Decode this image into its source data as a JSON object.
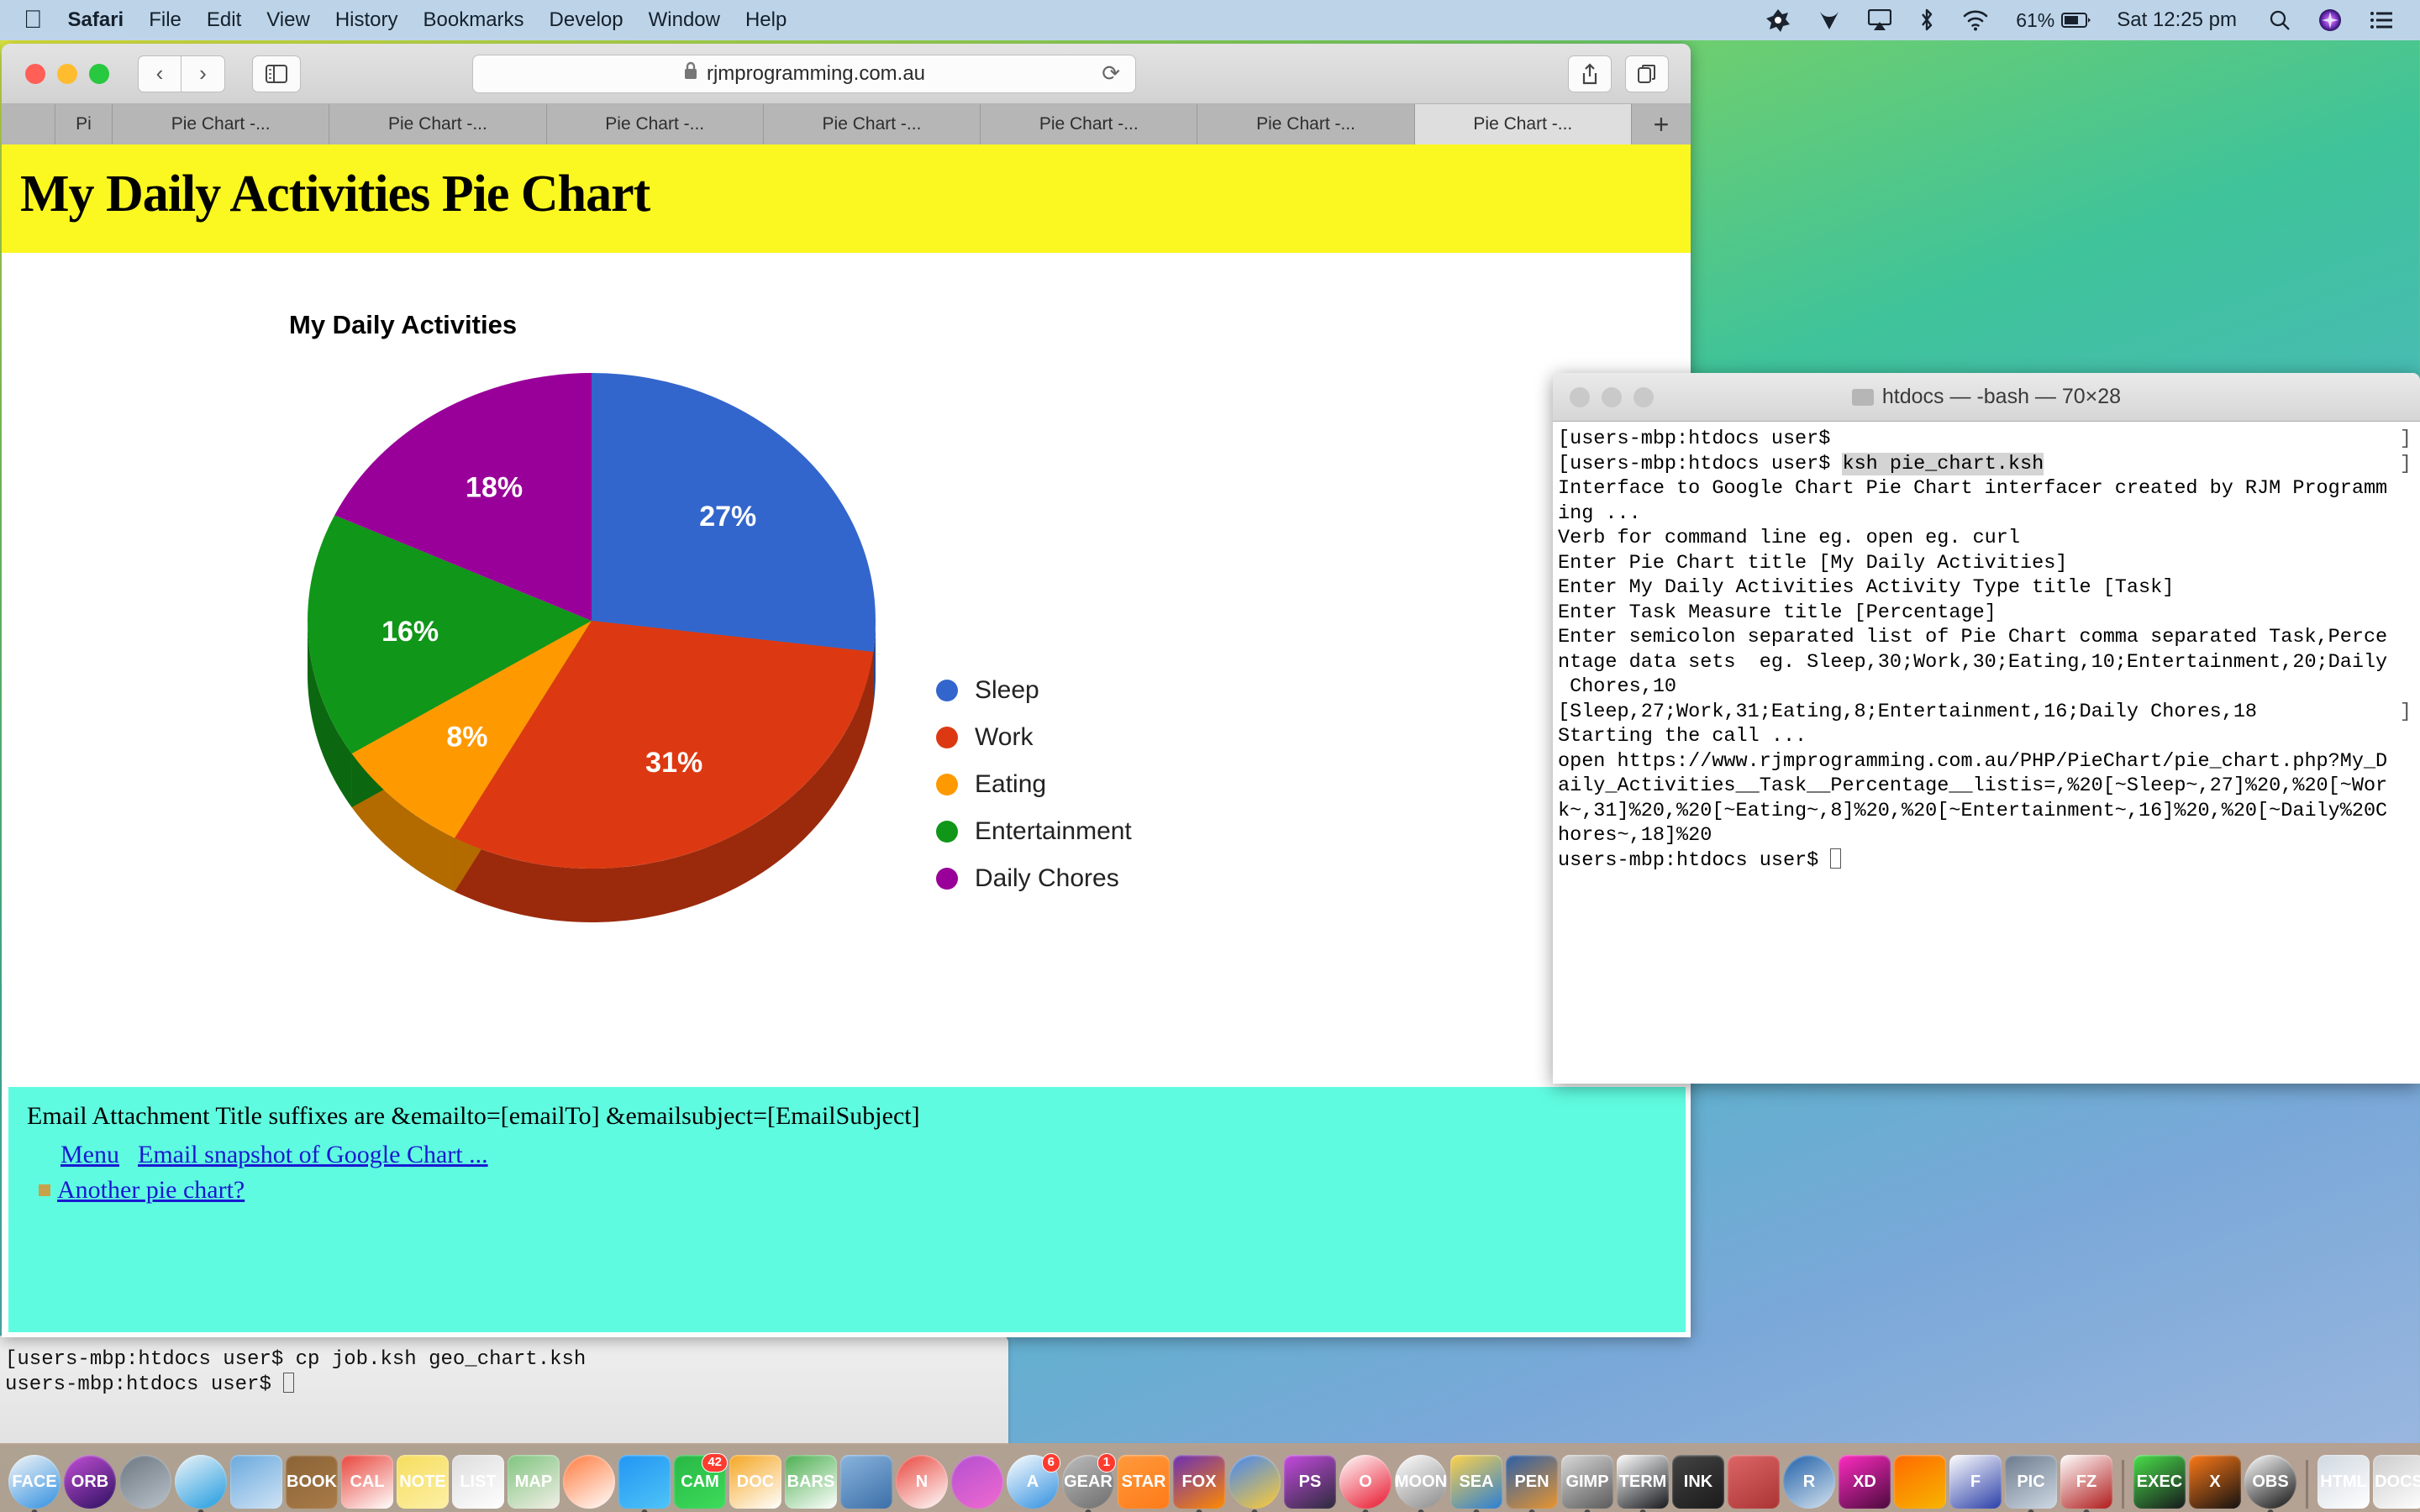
{
  "menubar": {
    "apple_icon": "apple-logo-icon",
    "items": [
      {
        "label": "Safari",
        "bold": true
      },
      {
        "label": "File",
        "bold": false
      },
      {
        "label": "Edit",
        "bold": false
      },
      {
        "label": "View",
        "bold": false
      },
      {
        "label": "History",
        "bold": false
      },
      {
        "label": "Bookmarks",
        "bold": false
      },
      {
        "label": "Develop",
        "bold": false
      },
      {
        "label": "Window",
        "bold": false
      },
      {
        "label": "Help",
        "bold": false
      }
    ],
    "extras": [
      {
        "name": "avast-icon"
      },
      {
        "name": "malwarebytes-icon"
      },
      {
        "name": "airplay-icon"
      },
      {
        "name": "bluetooth-icon"
      },
      {
        "name": "wifi-icon"
      }
    ],
    "battery_percent": "61%",
    "clock": "Sat 12:25 pm",
    "search_icon": "spotlight-search-icon",
    "siri_icon": "siri-icon",
    "control_center_icon": "notification-center-icon"
  },
  "safari": {
    "url": "rjmprogramming.com.au",
    "lock_icon": "lock-icon",
    "reload_icon": "reload-icon",
    "back_icon": "chevron-left-icon",
    "forward_icon": "chevron-right-icon",
    "sidebar_icon": "sidebar-toggle-icon",
    "share_icon": "share-icon",
    "tabs_icon": "show-all-tabs-icon",
    "new_tab_label": "+",
    "tabs": [
      {
        "label": "Pi",
        "active": false,
        "narrow": true
      },
      {
        "label": "Pie Chart -...",
        "active": false
      },
      {
        "label": "Pie Chart -...",
        "active": false
      },
      {
        "label": "Pie Chart -...",
        "active": false
      },
      {
        "label": "Pie Chart -...",
        "active": false
      },
      {
        "label": "Pie Chart -...",
        "active": false
      },
      {
        "label": "Pie Chart -...",
        "active": false
      },
      {
        "label": "Pie Chart -...",
        "active": true
      }
    ]
  },
  "page": {
    "banner_title": "My Daily Activities Pie Chart",
    "banner_color": "#fbf721",
    "footer_color": "#5ffbe0",
    "footer_text": "Email Attachment Title suffixes are &emailto=[emailTo] &emailsubject=[EmailSubject]",
    "links": [
      {
        "label": "Menu"
      },
      {
        "label": "Email snapshot of Google Chart ..."
      },
      {
        "label": "Another pie chart?"
      }
    ]
  },
  "chart_data": {
    "type": "pie",
    "title": "My Daily Activities",
    "categories": [
      "Sleep",
      "Work",
      "Eating",
      "Entertainment",
      "Daily Chores"
    ],
    "values": [
      27,
      31,
      8,
      16,
      18
    ],
    "labels": [
      "27%",
      "31%",
      "8%",
      "16%",
      "18%"
    ],
    "colors": [
      "#3366cc",
      "#dc3912",
      "#ff9900",
      "#109618",
      "#990099"
    ],
    "shade_colors": [
      "#26478d",
      "#9b2a0d",
      "#b36b00",
      "#0b6810",
      "#6b006b"
    ],
    "legend_position": "right",
    "three_d": true,
    "xlabel": "Task",
    "ylabel": "Percentage"
  },
  "terminal": {
    "title": "htdocs — -bash — 70×28",
    "folder_icon": "folder-icon",
    "lines": [
      {
        "text": "[users-mbp:htdocs user$",
        "trail": "]"
      },
      {
        "prefix": "[users-mbp:htdocs user$ ",
        "hl": "ksh pie_chart.ksh",
        "trail": "]"
      },
      {
        "text": "Interface to Google Chart Pie Chart interfacer created by RJM Programm"
      },
      {
        "text": "ing ..."
      },
      {
        "text": ""
      },
      {
        "text": "Verb for command line eg. open eg. curl"
      },
      {
        "text": ""
      },
      {
        "text": ""
      },
      {
        "text": "Enter Pie Chart title [My Daily Activities]"
      },
      {
        "text": ""
      },
      {
        "text": ""
      },
      {
        "text": "Enter My Daily Activities Activity Type title [Task]"
      },
      {
        "text": ""
      },
      {
        "text": ""
      },
      {
        "text": "Enter Task Measure title [Percentage]"
      },
      {
        "text": ""
      },
      {
        "text": ""
      },
      {
        "text": "Enter semicolon separated list of Pie Chart comma separated Task,Perce"
      },
      {
        "text": "ntage data sets  eg. Sleep,30;Work,30;Eating,10;Entertainment,20;Daily"
      },
      {
        "text": " Chores,10"
      },
      {
        "text": "[Sleep,27;Work,31;Eating,8;Entertainment,16;Daily Chores,18",
        "trail": "]"
      },
      {
        "text": ""
      },
      {
        "text": "Starting the call ..."
      },
      {
        "text": "open https://www.rjmprogramming.com.au/PHP/PieChart/pie_chart.php?My_D"
      },
      {
        "text": "aily_Activities__Task__Percentage__listis=,%20[~Sleep~,27]%20,%20[~Wor"
      },
      {
        "text": "k~,31]%20,%20[~Eating~,8]%20,%20[~Entertainment~,16]%20,%20[~Daily%20C"
      },
      {
        "text": "hores~,18]%20"
      },
      {
        "text": "users-mbp:htdocs user$ ",
        "cursor": true
      }
    ]
  },
  "background_terminal": {
    "lines": [
      "[users-mbp:htdocs user$ cp job.ksh geo_chart.ksh",
      "users-mbp:htdocs user$ "
    ]
  },
  "dock": {
    "items": [
      {
        "name": "finder-icon",
        "running": true,
        "badge": ""
      },
      {
        "name": "siri-icon",
        "running": false,
        "badge": ""
      },
      {
        "name": "launchpad-icon",
        "running": false,
        "badge": ""
      },
      {
        "name": "safari-icon",
        "running": true,
        "badge": ""
      },
      {
        "name": "mail-icon",
        "running": false,
        "badge": ""
      },
      {
        "name": "contacts-icon",
        "running": false,
        "badge": ""
      },
      {
        "name": "calendar-icon",
        "running": false,
        "badge": ""
      },
      {
        "name": "notes-icon",
        "running": false,
        "badge": ""
      },
      {
        "name": "reminders-icon",
        "running": false,
        "badge": ""
      },
      {
        "name": "maps-icon",
        "running": false,
        "badge": ""
      },
      {
        "name": "photos-icon",
        "running": false,
        "badge": ""
      },
      {
        "name": "messages-icon",
        "running": true,
        "badge": ""
      },
      {
        "name": "facetime-icon",
        "running": false,
        "badge": "42"
      },
      {
        "name": "pages-icon",
        "running": false,
        "badge": ""
      },
      {
        "name": "numbers-icon",
        "running": false,
        "badge": ""
      },
      {
        "name": "keynote-icon",
        "running": false,
        "badge": ""
      },
      {
        "name": "news-icon",
        "running": false,
        "badge": ""
      },
      {
        "name": "itunes-icon",
        "running": false,
        "badge": ""
      },
      {
        "name": "app-store-icon",
        "running": false,
        "badge": "6"
      },
      {
        "name": "system-preferences-icon",
        "running": true,
        "badge": "1"
      },
      {
        "name": "avast-icon",
        "running": false,
        "badge": ""
      },
      {
        "name": "firefox-icon",
        "running": true,
        "badge": ""
      },
      {
        "name": "chrome-icon",
        "running": true,
        "badge": ""
      },
      {
        "name": "phpstorm-icon",
        "running": false,
        "badge": ""
      },
      {
        "name": "opera-icon",
        "running": true,
        "badge": ""
      },
      {
        "name": "pale-moon-icon",
        "running": true,
        "badge": ""
      },
      {
        "name": "seamonkey-icon",
        "running": true,
        "badge": ""
      },
      {
        "name": "textwrangler-icon",
        "running": true,
        "badge": ""
      },
      {
        "name": "gimp-icon",
        "running": true,
        "badge": ""
      },
      {
        "name": "terminal-icon",
        "running": true,
        "badge": ""
      },
      {
        "name": "inkscape-icon",
        "running": false,
        "badge": ""
      },
      {
        "name": "photo-booth-icon",
        "running": false,
        "badge": ""
      },
      {
        "name": "rstudio-icon",
        "running": false,
        "badge": ""
      },
      {
        "name": "adobe-xd-icon",
        "running": false,
        "badge": ""
      },
      {
        "name": "sketch-icon",
        "running": false,
        "badge": ""
      },
      {
        "name": "filemaker-icon",
        "running": false,
        "badge": ""
      },
      {
        "name": "preview-icon",
        "running": true,
        "badge": ""
      },
      {
        "name": "filezilla-icon",
        "running": true,
        "badge": ""
      },
      {
        "name": "separator",
        "running": false,
        "badge": ""
      },
      {
        "name": "exec-icon",
        "running": false,
        "badge": ""
      },
      {
        "name": "xquartz-icon",
        "running": false,
        "badge": ""
      },
      {
        "name": "obs-icon",
        "running": true,
        "badge": ""
      },
      {
        "name": "separator",
        "running": false,
        "badge": ""
      },
      {
        "name": "html-file-icon",
        "running": false,
        "badge": ""
      },
      {
        "name": "document-stack-icon",
        "running": false,
        "badge": ""
      },
      {
        "name": "trash-icon",
        "running": false,
        "badge": ""
      }
    ]
  }
}
